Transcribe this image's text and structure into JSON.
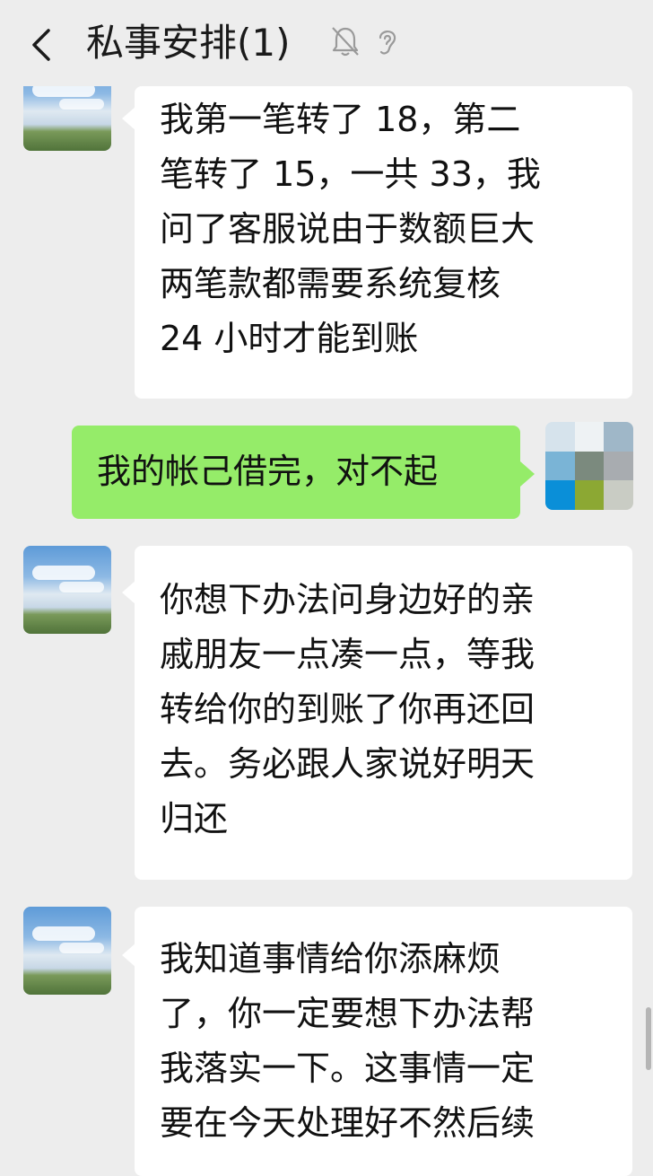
{
  "header": {
    "title": "私事安排(1)",
    "back_icon": "chevron-left-icon",
    "mute_icon": "bell-off-icon",
    "earpiece_icon": "ear-icon"
  },
  "messages": [
    {
      "side": "left",
      "lines": [
        "我第一笔转了 18，第二",
        "笔转了 15，一共 33，我",
        "问了客服说由于数额巨大",
        "两笔款都需要系统复核",
        "24 小时才能到账"
      ]
    },
    {
      "side": "right",
      "lines": [
        "我的帐己借完，对不起"
      ]
    },
    {
      "side": "left",
      "lines": [
        "你想下办法问身边好的亲",
        "戚朋友一点凑一点，等我",
        "转给你的到账了你再还回",
        "去。务必跟人家说好明天",
        "归还"
      ]
    },
    {
      "side": "left",
      "lines": [
        "我知道事情给你添麻烦",
        "了，你一定要想下办法帮",
        "我落实一下。这事情一定",
        "要在今天处理好不然后续"
      ]
    }
  ],
  "colors": {
    "background": "#ededed",
    "incoming_bubble": "#ffffff",
    "outgoing_bubble": "#95ec69"
  }
}
